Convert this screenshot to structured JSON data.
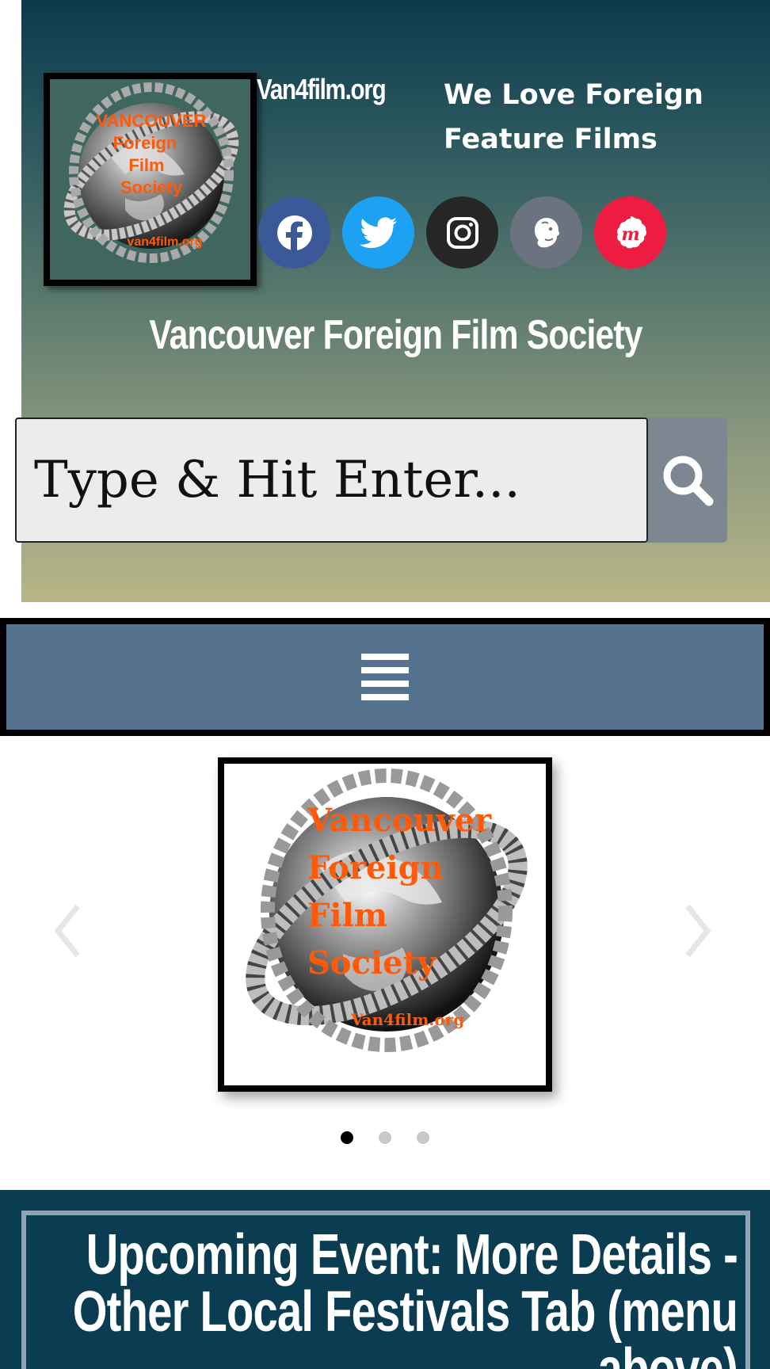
{
  "header": {
    "site_url": "Van4film.org",
    "tagline": "We Love Foreign Feature Films",
    "society_name": "Vancouver Foreign Film Society",
    "logo": {
      "line1": "VANCOUVER",
      "line2": "Foreign",
      "line3": "Film",
      "line4": "Society",
      "line5": "van4film.org"
    },
    "social": [
      {
        "name": "facebook",
        "icon": "facebook-icon",
        "color": "#3b5998"
      },
      {
        "name": "twitter",
        "icon": "twitter-icon",
        "color": "#1da1f2"
      },
      {
        "name": "instagram",
        "icon": "instagram-icon",
        "color": "#262626"
      },
      {
        "name": "mailchimp",
        "icon": "mailchimp-icon",
        "color": "#6b7280"
      },
      {
        "name": "meetup",
        "icon": "meetup-icon",
        "color": "#ed1c40"
      }
    ]
  },
  "search": {
    "placeholder": "Type & Hit Enter...",
    "button_icon": "search-icon"
  },
  "nav": {
    "menu_icon": "hamburger-menu-icon"
  },
  "carousel": {
    "slide_logo": {
      "line1": "Vancouver",
      "line2": "Foreign",
      "line3": "Film",
      "line4": "Society",
      "line5": "Van4film.org"
    },
    "dot_count": 3,
    "active_dot": 0
  },
  "event": {
    "title": "Upcoming Event: More Details - Other Local Festivals Tab (menu above)"
  },
  "colors": {
    "header_top": "#0b3a4d",
    "header_bottom": "#b8b687",
    "nav_bg": "#55738f",
    "event_bg": "#0a3d52",
    "logo_text": "#ff5a0a"
  }
}
